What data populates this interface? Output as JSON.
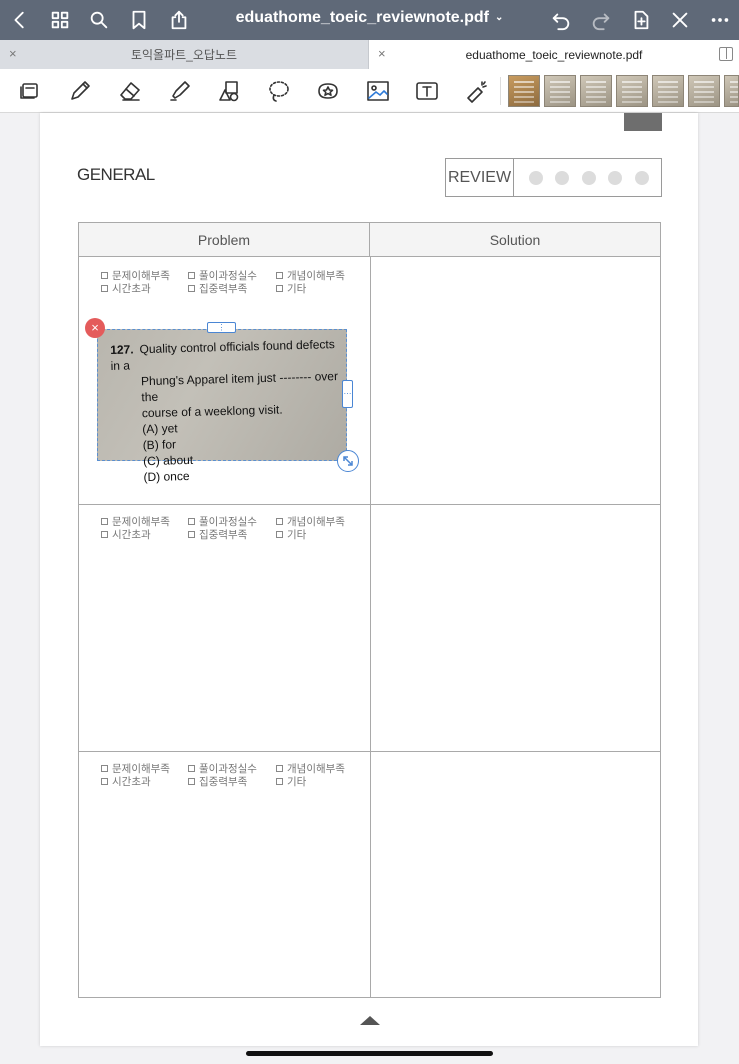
{
  "topbar": {
    "title": "eduathome_toeic_reviewnote.pdf",
    "title_caret": "⌄",
    "icons": [
      "back-icon",
      "grid-icon",
      "search-icon",
      "bookmark-icon",
      "share-icon",
      "undo-icon",
      "redo-icon",
      "add-page-icon",
      "close-icon",
      "more-icon"
    ]
  },
  "tabs": [
    {
      "label": "토익올파트_오답노트",
      "active": false,
      "close": "×"
    },
    {
      "label": "eduathome_toeic_reviewnote.pdf",
      "active": true,
      "close": "×"
    }
  ],
  "toolbar": {
    "tools": [
      "page-view-icon",
      "pen-icon",
      "eraser-icon",
      "highlighter-icon",
      "shape-icon",
      "lasso-icon",
      "sticker-icon",
      "image-icon",
      "text-icon",
      "laser-pointer-icon"
    ],
    "thumbnails_count": 7
  },
  "page": {
    "section_title": "GENERAL",
    "review_label": "REVIEW",
    "review_dots": 5,
    "columns": {
      "problem": "Problem",
      "solution": "Solution"
    },
    "checkboxes": [
      "문제이해부족",
      "풀이과정실수",
      "개념이해부족",
      "시간초과",
      "집중력부족",
      "기타"
    ],
    "photo": {
      "question_number": "127.",
      "question_line1": "Quality control officials found defects in a",
      "question_line2": "Phung's Apparel item just -------- over the",
      "question_line3": "course of a weeklong visit.",
      "options": [
        "(A)  yet",
        "(B)  for",
        "(C)  about",
        "(D)  once"
      ]
    },
    "delete_glyph": "×",
    "handle_top_glyph": "⋮",
    "handle_right_glyph": "⋯"
  },
  "colors": {
    "topbar": "#5f6978",
    "delete_handle": "#e45b5b",
    "selection": "#4a86d4"
  }
}
